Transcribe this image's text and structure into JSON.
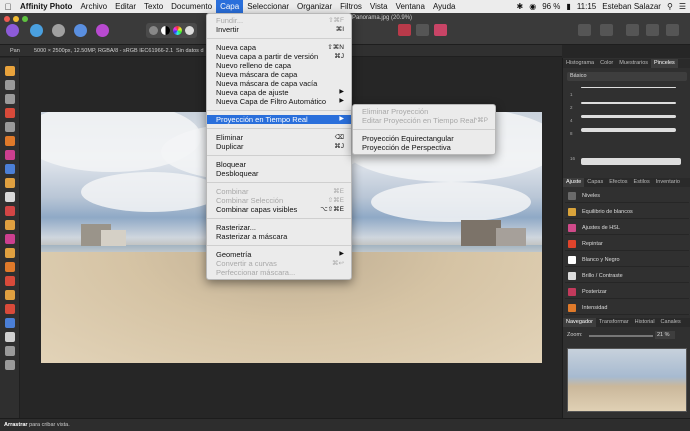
{
  "menubar": {
    "app": "Affinity Photo",
    "items": [
      "Archivo",
      "Editar",
      "Texto",
      "Documento",
      "Capa",
      "Seleccionar",
      "Organizar",
      "Filtros",
      "Vista",
      "Ventana",
      "Ayuda"
    ],
    "active": "Capa",
    "battery": "96 %",
    "time": "11:15",
    "user": "Esteban Salazar"
  },
  "document": {
    "title": "Panorama.jpg (20.9%)",
    "info": "5000 × 2500px, 12.50MP, RGBA/8 - sRGB IEC61966-2.1",
    "meta": "Sin datos d",
    "tool": "Pan"
  },
  "layer_menu": {
    "items": [
      {
        "label": "Fundir...",
        "shortcut": "⇧⌘F",
        "disabled": true
      },
      {
        "label": "Invertir",
        "shortcut": "⌘I"
      },
      {
        "sep": true
      },
      {
        "label": "Nueva capa",
        "shortcut": "⇧⌘N"
      },
      {
        "label": "Nueva capa a partir de versión",
        "shortcut": "⌘J"
      },
      {
        "label": "Nuevo relleno de capa"
      },
      {
        "label": "Nueva máscara de capa"
      },
      {
        "label": "Nueva máscara de capa vacía"
      },
      {
        "label": "Nueva capa de ajuste",
        "submenu": true
      },
      {
        "label": "Nueva Capa de Filtro Automático",
        "submenu": true
      },
      {
        "sep": true
      },
      {
        "label": "Proyección en Tiempo Real",
        "submenu": true,
        "highlighted": true
      },
      {
        "sep": true
      },
      {
        "label": "Eliminar",
        "shortcut": "⌫"
      },
      {
        "label": "Duplicar",
        "shortcut": "⌘J"
      },
      {
        "sep": true
      },
      {
        "label": "Bloquear"
      },
      {
        "label": "Desbloquear"
      },
      {
        "sep": true
      },
      {
        "label": "Combinar",
        "shortcut": "⌘E",
        "disabled": true
      },
      {
        "label": "Combinar Selección",
        "shortcut": "⇧⌘E",
        "disabled": true
      },
      {
        "label": "Combinar capas visibles",
        "shortcut": "⌥⇧⌘E"
      },
      {
        "sep": true
      },
      {
        "label": "Rasterizar..."
      },
      {
        "label": "Rasterizar a máscara"
      },
      {
        "sep": true
      },
      {
        "label": "Geometría",
        "submenu": true
      },
      {
        "label": "Convertir a curvas",
        "shortcut": "⌘↩",
        "disabled": true
      },
      {
        "label": "Perfeccionar máscara...",
        "disabled": true
      }
    ]
  },
  "projection_submenu": {
    "items": [
      {
        "label": "Eliminar Proyección",
        "disabled": true
      },
      {
        "label": "Editar Proyección en Tiempo Real",
        "shortcut": "^⌘P",
        "disabled": true
      },
      {
        "sep": true
      },
      {
        "label": "Proyección Equirectangular"
      },
      {
        "label": "Proyección de Perspectiva"
      }
    ]
  },
  "right_panel": {
    "top_tabs": [
      "Histograma",
      "Color",
      "Muestrarios",
      "Pinceles"
    ],
    "top_active": "Pinceles",
    "brush_category": "Básico",
    "brush_sizes": [
      "1",
      "2",
      "4",
      "8",
      "16"
    ],
    "mid_tabs": [
      "Ajuste",
      "Capas",
      "Efectos",
      "Estilos",
      "Inventario"
    ],
    "mid_active": "Ajuste",
    "adjustments": [
      {
        "label": "Niveles",
        "color": "#6a6a6a"
      },
      {
        "label": "Equilibrio de blancos",
        "color": "#d9a33b"
      },
      {
        "label": "Ajustes de HSL",
        "color": "#d04a8a"
      },
      {
        "label": "Repintar",
        "color": "#e0442c"
      },
      {
        "label": "Blanco y Negro",
        "color": "#ffffff"
      },
      {
        "label": "Brillo / Contraste",
        "color": "#dcdcdc"
      },
      {
        "label": "Posterizar",
        "color": "#c23a5c"
      },
      {
        "label": "Intensidad",
        "color": "#e07a2a"
      }
    ],
    "nav_tabs": [
      "Navegador",
      "Transformar",
      "Historial",
      "Canales"
    ],
    "nav_active": "Navegador",
    "zoom_label": "Zoom:",
    "zoom_value": "21 %"
  },
  "status": {
    "bold": "Arrastrar",
    "text": "para cribar vista."
  }
}
